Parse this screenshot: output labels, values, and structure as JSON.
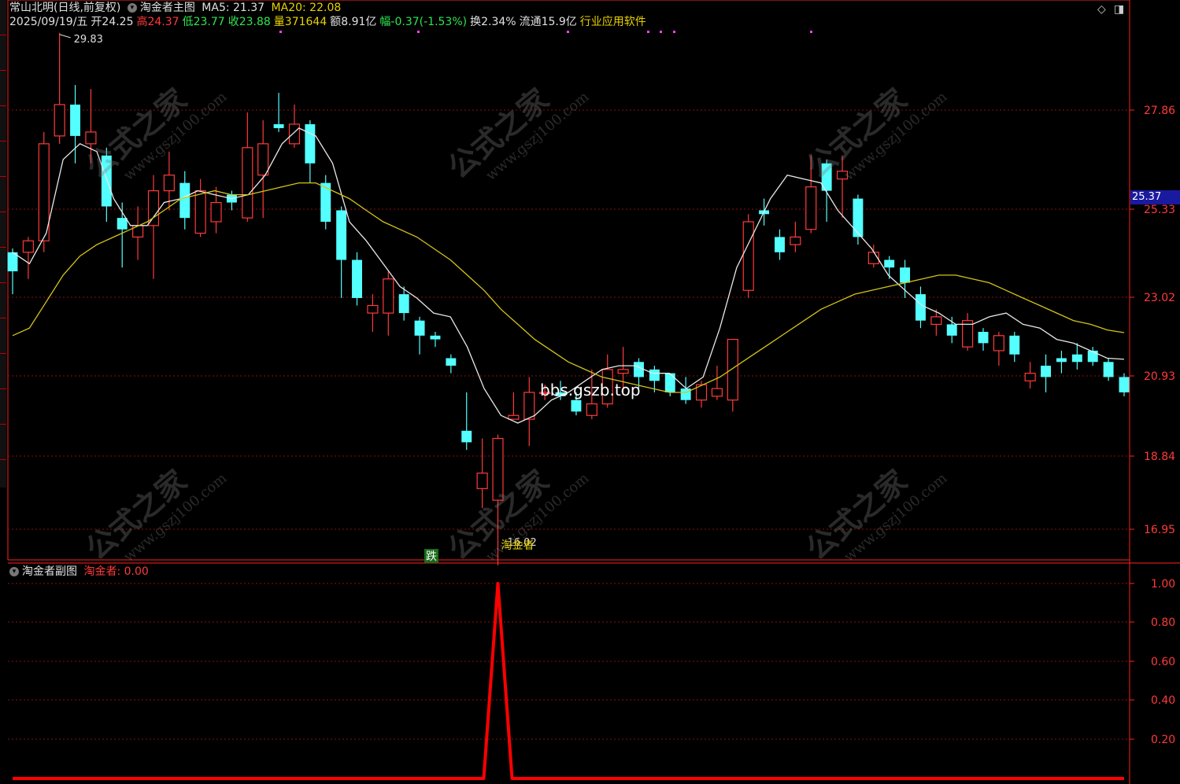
{
  "header": {
    "stock_name": "常山北明(日线,前复权)",
    "main_indicator": "淘金者主图",
    "ma5_label": "MA5: 21.37",
    "ma20_label": "MA20: 22.08",
    "date": "2025/09/19/五",
    "open": "开24.25",
    "high": "高24.37",
    "low": "低23.77",
    "close": "收23.88",
    "volume": "量371644",
    "amount": "额8.91亿",
    "change": "幅-0.37(-1.53%)",
    "turnover": "换2.34%",
    "float_cap": "流通15.9亿",
    "industry": "行业应用软件"
  },
  "sub_header": {
    "name": "淘金者副图",
    "indicator": "淘金者: 0.00"
  },
  "watermark": {
    "big": "公式之家",
    "small": "www.gszj100.com"
  },
  "overlay_text": "bbs.gszb.top",
  "current_price_tag": "25.37",
  "annotations": {
    "peak": "29.83",
    "trough": "16.02",
    "signal": "跌",
    "trough_label": "淘金者"
  },
  "colors": {
    "up": "#ff3a3a",
    "down": "#54ffff",
    "ma5": "#e8e8e8",
    "ma20": "#d4c418",
    "grid": "#8a1010",
    "axis": "#ff2020",
    "sub_line": "#ff0000"
  },
  "chart_data": [
    {
      "type": "candlestick",
      "title": "淘金者主图",
      "y_ticks": [
        "27.86",
        "25.33",
        "23.02",
        "20.93",
        "18.84",
        "16.95"
      ],
      "ylim": [
        16.02,
        30.5
      ],
      "series": [
        {
          "name": "MA5",
          "values": [
            24.2,
            23.9,
            24.7,
            26.6,
            27.0,
            26.8,
            25.6,
            24.9,
            24.9,
            25.5,
            25.6,
            25.8,
            25.7,
            25.6,
            25.7,
            26.2,
            27.0,
            27.4,
            27.2,
            26.5,
            25.0,
            24.5,
            23.9,
            23.3,
            23.0,
            22.6,
            22.5,
            21.7,
            20.6,
            19.9,
            19.7,
            19.9,
            20.3,
            20.5,
            20.8,
            21.1,
            21.2,
            21.2,
            21.0,
            21.0,
            20.6,
            20.9,
            22.2,
            23.8,
            24.7,
            25.6,
            26.2,
            26.1,
            26.0,
            25.3,
            24.8,
            24.3,
            23.6,
            23.2,
            22.8,
            22.6,
            22.3,
            22.3,
            22.5,
            22.6,
            22.3,
            22.2,
            21.9,
            21.8,
            21.6,
            21.4,
            21.37
          ]
        },
        {
          "name": "MA20",
          "values": [
            22.0,
            22.2,
            22.9,
            23.6,
            24.1,
            24.4,
            24.6,
            24.8,
            25.0,
            25.3,
            25.6,
            25.7,
            25.8,
            25.7,
            25.7,
            25.8,
            25.9,
            26.0,
            26.0,
            25.8,
            25.6,
            25.3,
            25.0,
            24.8,
            24.6,
            24.3,
            24.0,
            23.6,
            23.2,
            22.7,
            22.3,
            21.9,
            21.6,
            21.3,
            21.1,
            20.9,
            20.8,
            20.7,
            20.6,
            20.5,
            20.5,
            20.7,
            20.9,
            21.2,
            21.5,
            21.8,
            22.1,
            22.4,
            22.7,
            22.9,
            23.1,
            23.2,
            23.3,
            23.4,
            23.5,
            23.6,
            23.6,
            23.5,
            23.4,
            23.2,
            23.0,
            22.8,
            22.6,
            22.4,
            22.3,
            22.15,
            22.08
          ]
        }
      ],
      "candles": [
        [
          24.2,
          23.7,
          24.3,
          23.1
        ],
        [
          24.2,
          24.5,
          24.6,
          23.5
        ],
        [
          24.5,
          27.0,
          27.3,
          24.2
        ],
        [
          27.2,
          28.0,
          29.83,
          27.0
        ],
        [
          28.0,
          27.2,
          28.5,
          26.5
        ],
        [
          27.0,
          27.3,
          28.4,
          26.5
        ],
        [
          26.7,
          25.4,
          26.9,
          25.0
        ],
        [
          25.1,
          24.8,
          25.5,
          23.8
        ],
        [
          24.6,
          24.9,
          25.4,
          24.0
        ],
        [
          24.9,
          25.8,
          26.2,
          23.5
        ],
        [
          25.8,
          26.2,
          26.8,
          25.3
        ],
        [
          26.0,
          25.1,
          26.3,
          24.8
        ],
        [
          24.7,
          25.8,
          26.1,
          24.6
        ],
        [
          25.0,
          25.5,
          25.9,
          24.7
        ],
        [
          25.7,
          25.5,
          25.8,
          25.3
        ],
        [
          25.1,
          26.9,
          27.8,
          25.0
        ],
        [
          26.2,
          27.0,
          27.6,
          25.1
        ],
        [
          27.5,
          27.4,
          28.3,
          27.3
        ],
        [
          27.0,
          27.5,
          28.0,
          26.9
        ],
        [
          27.5,
          26.5,
          27.6,
          26.0
        ],
        [
          26.0,
          25.0,
          26.2,
          24.8
        ],
        [
          25.3,
          24.0,
          25.4,
          23.0
        ],
        [
          24.0,
          23.0,
          24.2,
          22.8
        ],
        [
          22.6,
          22.8,
          23.1,
          22.1
        ],
        [
          22.6,
          23.5,
          23.7,
          22.0
        ],
        [
          23.1,
          22.6,
          23.3,
          22.4
        ],
        [
          22.4,
          22.0,
          22.5,
          21.5
        ],
        [
          22.0,
          21.9,
          22.1,
          21.7
        ],
        [
          21.4,
          21.2,
          21.5,
          21.0
        ],
        [
          19.5,
          19.2,
          20.5,
          19.0
        ],
        [
          18.0,
          18.4,
          19.3,
          17.5
        ],
        [
          17.7,
          19.3,
          19.4,
          16.02
        ],
        [
          19.8,
          19.9,
          20.5,
          19.8
        ],
        [
          19.8,
          20.5,
          20.9,
          19.1
        ],
        [
          20.5,
          20.5,
          20.7,
          20.3
        ],
        [
          20.5,
          20.4,
          20.8,
          20.3
        ],
        [
          20.3,
          20.0,
          20.5,
          19.9
        ],
        [
          19.9,
          20.2,
          21.1,
          19.8
        ],
        [
          20.2,
          21.1,
          21.5,
          20.1
        ],
        [
          21.0,
          21.1,
          21.7,
          20.5
        ],
        [
          21.3,
          20.9,
          21.4,
          20.6
        ],
        [
          21.1,
          20.8,
          21.2,
          20.5
        ],
        [
          21.0,
          20.5,
          21.0,
          20.4
        ],
        [
          20.6,
          20.3,
          20.9,
          20.2
        ],
        [
          20.3,
          20.7,
          20.8,
          20.1
        ],
        [
          20.4,
          20.6,
          21.2,
          20.3
        ],
        [
          20.3,
          21.9,
          21.9,
          20.0
        ],
        [
          23.2,
          25.0,
          25.2,
          23.0
        ],
        [
          25.3,
          25.2,
          25.6,
          24.9
        ],
        [
          24.6,
          24.2,
          24.8,
          24.0
        ],
        [
          24.4,
          24.6,
          25.0,
          24.2
        ],
        [
          24.8,
          25.9,
          26.7,
          24.7
        ],
        [
          26.5,
          25.8,
          26.6,
          25.0
        ],
        [
          26.1,
          26.3,
          26.7,
          25.1
        ],
        [
          25.6,
          24.6,
          25.7,
          24.4
        ],
        [
          23.9,
          24.2,
          24.4,
          23.8
        ],
        [
          24.0,
          23.8,
          24.1,
          23.5
        ],
        [
          23.8,
          23.4,
          24.0,
          23.0
        ],
        [
          23.1,
          22.4,
          23.3,
          22.2
        ],
        [
          22.3,
          22.5,
          22.7,
          22.0
        ],
        [
          22.3,
          22.0,
          22.5,
          21.8
        ],
        [
          21.7,
          22.4,
          22.6,
          21.6
        ],
        [
          22.1,
          21.8,
          22.2,
          21.6
        ],
        [
          21.6,
          22.0,
          22.1,
          21.2
        ],
        [
          22.0,
          21.5,
          22.1,
          21.3
        ],
        [
          20.8,
          21.0,
          21.3,
          20.6
        ],
        [
          21.2,
          20.9,
          21.5,
          20.5
        ],
        [
          21.4,
          21.3,
          21.6,
          21.0
        ],
        [
          21.5,
          21.3,
          21.8,
          21.1
        ],
        [
          21.6,
          21.3,
          21.7,
          21.2
        ],
        [
          21.3,
          20.9,
          21.4,
          20.8
        ],
        [
          20.9,
          20.5,
          21.0,
          20.4
        ]
      ]
    },
    {
      "type": "line",
      "title": "淘金者副图",
      "y_ticks": [
        "1.00",
        "0.80",
        "0.60",
        "0.40",
        "0.20"
      ],
      "ylim": [
        0,
        1.0
      ],
      "series": [
        {
          "name": "淘金者",
          "spike_index": 31,
          "spike_value": 1.0,
          "baseline": 0.0
        }
      ]
    }
  ]
}
